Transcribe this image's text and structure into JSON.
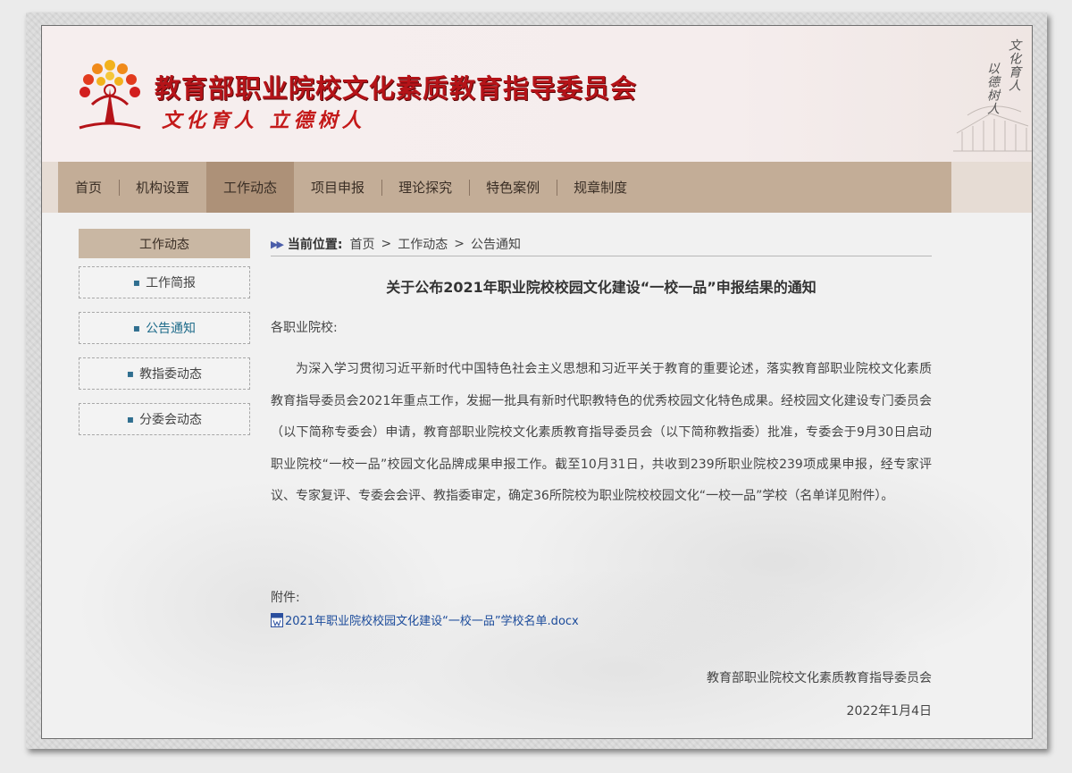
{
  "header": {
    "title": "教育部职业院校文化素质教育指导委员会",
    "slogan": "文化育人 立德树人",
    "art_line1": "文化育人",
    "art_line2": "以德树人"
  },
  "nav": {
    "items": [
      "首页",
      "机构设置",
      "工作动态",
      "项目申报",
      "理论探究",
      "特色案例",
      "规章制度"
    ],
    "active": "工作动态"
  },
  "sidebar": {
    "heading": "工作动态",
    "items": [
      "工作简报",
      "公告通知",
      "教指委动态",
      "分委会动态"
    ],
    "active": "公告通知"
  },
  "breadcrumb": {
    "lead": "当前位置:",
    "path": [
      "首页",
      "工作动态",
      "公告通知"
    ]
  },
  "article": {
    "title": "关于公布2021年职业院校校园文化建设“一校一品”申报结果的通知",
    "salutation": "各职业院校:",
    "body": "为深入学习贯彻习近平新时代中国特色社会主义思想和习近平关于教育的重要论述，落实教育部职业院校文化素质教育指导委员会2021年重点工作，发掘一批具有新时代职教特色的优秀校园文化特色成果。经校园文化建设专门委员会（以下简称专委会）申请，教育部职业院校文化素质教育指导委员会（以下简称教指委）批准，专委会于9月30日启动职业院校“一校一品”校园文化品牌成果申报工作。截至10月31日，共收到239所职业院校239项成果申报，经专家评议、专家复评、专委会会评、教指委审定，确定36所院校为职业院校校园文化“一校一品”学校（名单详见附件）。",
    "attachment_label": "附件:",
    "attachment_file": "2021年职业院校校园文化建设“一校一品”学校名单.docx",
    "signature_org": "教育部职业院校文化素质教育指导委员会",
    "signature_date": "2022年1月4日"
  },
  "colors": {
    "brand_red": "#b51318",
    "nav_bg": "#c3ad97",
    "nav_active": "#ad9178",
    "link_blue": "#1a4a9a"
  }
}
